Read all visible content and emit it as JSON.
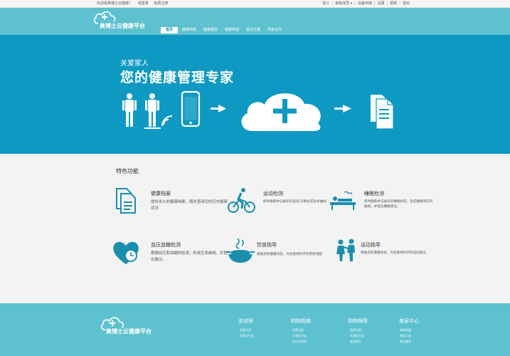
{
  "topbar": {
    "welcome": "欢迎来奥博士云健康！",
    "login": "请登录",
    "register": "免费注册",
    "links": [
      "张三",
      "家庭成员 ▾",
      "设备商城",
      "设置",
      "帮助",
      "退出"
    ]
  },
  "header": {
    "logo_text": "奥博士云健康平台",
    "nav": [
      "首页",
      "健康档案",
      "健康报告",
      "健康商城",
      "解决方案",
      "商家合作"
    ],
    "active_index": 0
  },
  "banner": {
    "subtitle": "关爱家人",
    "title": "您的健康管理专家"
  },
  "features": {
    "heading": "特色功能",
    "items": [
      {
        "icon": "documents-icon",
        "name": "健康档案",
        "desc": "提供永久的健康档案，随时查阅您的历史健康状况"
      },
      {
        "icon": "cyclist-icon",
        "name": "运动检测",
        "desc": "即时跟踪并记录您的运动,云端生成生命曲线"
      },
      {
        "icon": "sleeping-person-icon",
        "name": "睡眠检测",
        "desc": "即时跟踪并记录您的睡眠状态，生成睡眠状态的曲线，并提出睡眠建议。"
      },
      {
        "icon": "blood-pressure-heart-icon",
        "name": "血压血糖检测",
        "desc": "根据血压和血糖的检测，形成生命曲线，并提出建议。"
      },
      {
        "icon": "food-bowl-icon",
        "name": "饮食指导",
        "desc": "根据您的健康状态，为您提供科学的营养调配"
      },
      {
        "icon": "trainer-icon",
        "name": "运动指导",
        "desc": "根据您的健康状态，为您提供科学的运动建议"
      }
    ]
  },
  "footer": {
    "logo_text": "奥博士云健康平台",
    "columns": [
      {
        "heading": "咨询师",
        "links": [
          "免费注册",
          "开通支付宝"
        ]
      },
      {
        "heading": "购物指南",
        "links": [
          "免费注册",
          "开通支付宝",
          "支付宝充值"
        ]
      },
      {
        "heading": "购物保障",
        "links": [
          "免费注册",
          "开通支付宝",
          "就自助行"
        ]
      },
      {
        "heading": "商家中心",
        "links": [
          "商家联盟",
          "商家公告",
          "商业服务"
        ]
      }
    ]
  },
  "colors": {
    "header_bg": "#5ec1cf",
    "banner_bg": "#0e99c2",
    "accent": "#1a8fad",
    "page_bg": "#f3f3f3"
  }
}
